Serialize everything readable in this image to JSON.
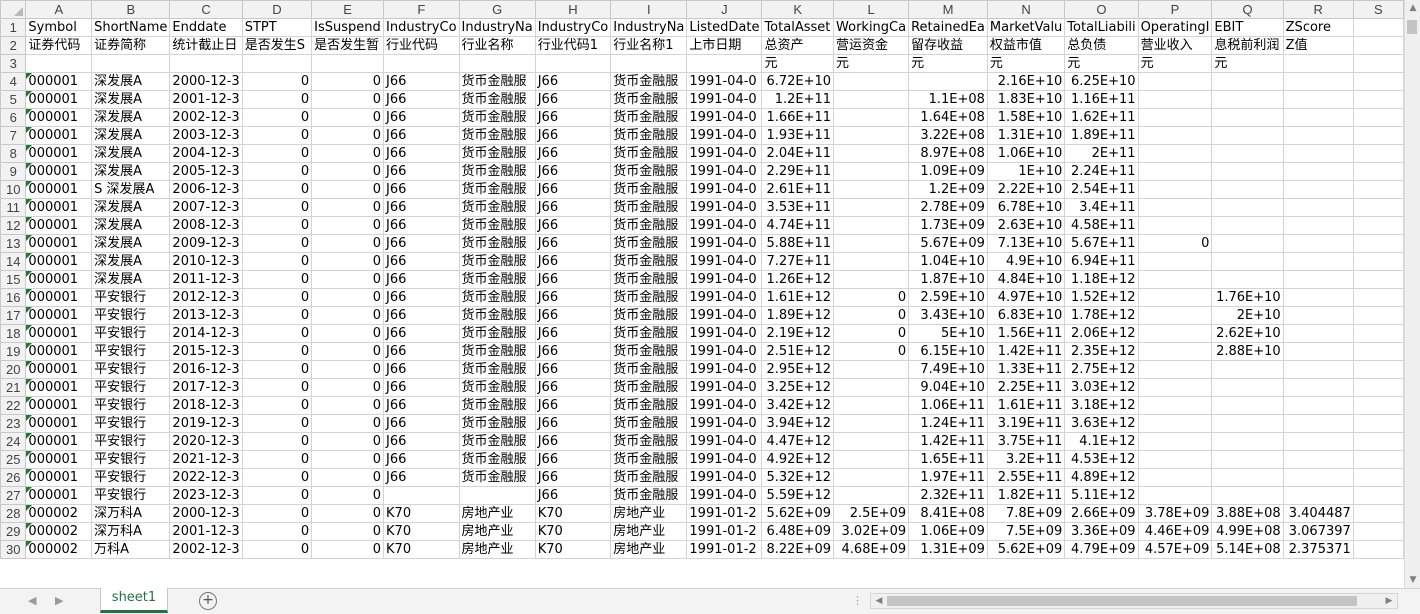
{
  "spreadsheet": {
    "columns": [
      "A",
      "B",
      "C",
      "D",
      "E",
      "F",
      "G",
      "H",
      "I",
      "J",
      "K",
      "L",
      "M",
      "N",
      "O",
      "P",
      "Q",
      "R",
      "S"
    ],
    "rows": [
      {
        "n": "1",
        "cells": [
          "Symbol",
          "ShortName",
          "Enddate",
          "STPT",
          "IsSuspend",
          "IndustryCo",
          "IndustryNa",
          "IndustryCo",
          "IndustryNa",
          "ListedDate",
          "TotalAsset",
          "WorkingCa",
          "RetainedEa",
          "MarketValu",
          "TotalLiabili",
          "OperatingI",
          "EBIT",
          "ZScore",
          ""
        ]
      },
      {
        "n": "2",
        "cells": [
          "证券代码",
          "证券简称",
          "统计截止日",
          "是否发生S",
          "是否发生暂",
          "行业代码",
          "行业名称",
          "行业代码1",
          "行业名称1",
          "上市日期",
          "总资产",
          "营运资金",
          "留存收益",
          "权益市值",
          "总负债",
          "营业收入",
          "息税前利润",
          "Z值",
          ""
        ]
      },
      {
        "n": "3",
        "cells": [
          "",
          "",
          "",
          "",
          "",
          "",
          "",
          "",
          "",
          "",
          "元",
          "元",
          "元",
          "元",
          "元",
          "元",
          "元",
          "",
          ""
        ]
      },
      {
        "n": "4",
        "cells": [
          "000001",
          "深发展A",
          "2000-12-3",
          "0",
          "0",
          "J66",
          "货币金融服",
          "J66",
          "货币金融服",
          "1991-04-0",
          "6.72E+10",
          "",
          "",
          "2.16E+10",
          "6.25E+10",
          "",
          "",
          "",
          ""
        ]
      },
      {
        "n": "5",
        "cells": [
          "000001",
          "深发展A",
          "2001-12-3",
          "0",
          "0",
          "J66",
          "货币金融服",
          "J66",
          "货币金融服",
          "1991-04-0",
          "1.2E+11",
          "",
          "1.1E+08",
          "1.83E+10",
          "1.16E+11",
          "",
          "",
          "",
          ""
        ]
      },
      {
        "n": "6",
        "cells": [
          "000001",
          "深发展A",
          "2002-12-3",
          "0",
          "0",
          "J66",
          "货币金融服",
          "J66",
          "货币金融服",
          "1991-04-0",
          "1.66E+11",
          "",
          "1.64E+08",
          "1.58E+10",
          "1.62E+11",
          "",
          "",
          "",
          ""
        ]
      },
      {
        "n": "7",
        "cells": [
          "000001",
          "深发展A",
          "2003-12-3",
          "0",
          "0",
          "J66",
          "货币金融服",
          "J66",
          "货币金融服",
          "1991-04-0",
          "1.93E+11",
          "",
          "3.22E+08",
          "1.31E+10",
          "1.89E+11",
          "",
          "",
          "",
          ""
        ]
      },
      {
        "n": "8",
        "cells": [
          "000001",
          "深发展A",
          "2004-12-3",
          "0",
          "0",
          "J66",
          "货币金融服",
          "J66",
          "货币金融服",
          "1991-04-0",
          "2.04E+11",
          "",
          "8.97E+08",
          "1.06E+10",
          "2E+11",
          "",
          "",
          "",
          ""
        ]
      },
      {
        "n": "9",
        "cells": [
          "000001",
          "深发展A",
          "2005-12-3",
          "0",
          "0",
          "J66",
          "货币金融服",
          "J66",
          "货币金融服",
          "1991-04-0",
          "2.29E+11",
          "",
          "1.09E+09",
          "1E+10",
          "2.24E+11",
          "",
          "",
          "",
          ""
        ]
      },
      {
        "n": "10",
        "cells": [
          "000001",
          "S 深发展A",
          "2006-12-3",
          "0",
          "0",
          "J66",
          "货币金融服",
          "J66",
          "货币金融服",
          "1991-04-0",
          "2.61E+11",
          "",
          "1.2E+09",
          "2.22E+10",
          "2.54E+11",
          "",
          "",
          "",
          ""
        ]
      },
      {
        "n": "11",
        "cells": [
          "000001",
          "深发展A",
          "2007-12-3",
          "0",
          "0",
          "J66",
          "货币金融服",
          "J66",
          "货币金融服",
          "1991-04-0",
          "3.53E+11",
          "",
          "2.78E+09",
          "6.78E+10",
          "3.4E+11",
          "",
          "",
          "",
          ""
        ]
      },
      {
        "n": "12",
        "cells": [
          "000001",
          "深发展A",
          "2008-12-3",
          "0",
          "0",
          "J66",
          "货币金融服",
          "J66",
          "货币金融服",
          "1991-04-0",
          "4.74E+11",
          "",
          "1.73E+09",
          "2.63E+10",
          "4.58E+11",
          "",
          "",
          "",
          ""
        ]
      },
      {
        "n": "13",
        "cells": [
          "000001",
          "深发展A",
          "2009-12-3",
          "0",
          "0",
          "J66",
          "货币金融服",
          "J66",
          "货币金融服",
          "1991-04-0",
          "5.88E+11",
          "",
          "5.67E+09",
          "7.13E+10",
          "5.67E+11",
          "0",
          "",
          "",
          ""
        ]
      },
      {
        "n": "14",
        "cells": [
          "000001",
          "深发展A",
          "2010-12-3",
          "0",
          "0",
          "J66",
          "货币金融服",
          "J66",
          "货币金融服",
          "1991-04-0",
          "7.27E+11",
          "",
          "1.04E+10",
          "4.9E+10",
          "6.94E+11",
          "",
          "",
          "",
          ""
        ]
      },
      {
        "n": "15",
        "cells": [
          "000001",
          "深发展A",
          "2011-12-3",
          "0",
          "0",
          "J66",
          "货币金融服",
          "J66",
          "货币金融服",
          "1991-04-0",
          "1.26E+12",
          "",
          "1.87E+10",
          "4.84E+10",
          "1.18E+12",
          "",
          "",
          "",
          ""
        ]
      },
      {
        "n": "16",
        "cells": [
          "000001",
          "平安银行",
          "2012-12-3",
          "0",
          "0",
          "J66",
          "货币金融服",
          "J66",
          "货币金融服",
          "1991-04-0",
          "1.61E+12",
          "0",
          "2.59E+10",
          "4.97E+10",
          "1.52E+12",
          "",
          "1.76E+10",
          "",
          ""
        ]
      },
      {
        "n": "17",
        "cells": [
          "000001",
          "平安银行",
          "2013-12-3",
          "0",
          "0",
          "J66",
          "货币金融服",
          "J66",
          "货币金融服",
          "1991-04-0",
          "1.89E+12",
          "0",
          "3.43E+10",
          "6.83E+10",
          "1.78E+12",
          "",
          "2E+10",
          "",
          ""
        ]
      },
      {
        "n": "18",
        "cells": [
          "000001",
          "平安银行",
          "2014-12-3",
          "0",
          "0",
          "J66",
          "货币金融服",
          "J66",
          "货币金融服",
          "1991-04-0",
          "2.19E+12",
          "0",
          "5E+10",
          "1.56E+11",
          "2.06E+12",
          "",
          "2.62E+10",
          "",
          ""
        ]
      },
      {
        "n": "19",
        "cells": [
          "000001",
          "平安银行",
          "2015-12-3",
          "0",
          "0",
          "J66",
          "货币金融服",
          "J66",
          "货币金融服",
          "1991-04-0",
          "2.51E+12",
          "0",
          "6.15E+10",
          "1.42E+11",
          "2.35E+12",
          "",
          "2.88E+10",
          "",
          ""
        ]
      },
      {
        "n": "20",
        "cells": [
          "000001",
          "平安银行",
          "2016-12-3",
          "0",
          "0",
          "J66",
          "货币金融服",
          "J66",
          "货币金融服",
          "1991-04-0",
          "2.95E+12",
          "",
          "7.49E+10",
          "1.33E+11",
          "2.75E+12",
          "",
          "",
          "",
          ""
        ]
      },
      {
        "n": "21",
        "cells": [
          "000001",
          "平安银行",
          "2017-12-3",
          "0",
          "0",
          "J66",
          "货币金融服",
          "J66",
          "货币金融服",
          "1991-04-0",
          "3.25E+12",
          "",
          "9.04E+10",
          "2.25E+11",
          "3.03E+12",
          "",
          "",
          "",
          ""
        ]
      },
      {
        "n": "22",
        "cells": [
          "000001",
          "平安银行",
          "2018-12-3",
          "0",
          "0",
          "J66",
          "货币金融服",
          "J66",
          "货币金融服",
          "1991-04-0",
          "3.42E+12",
          "",
          "1.06E+11",
          "1.61E+11",
          "3.18E+12",
          "",
          "",
          "",
          ""
        ]
      },
      {
        "n": "23",
        "cells": [
          "000001",
          "平安银行",
          "2019-12-3",
          "0",
          "0",
          "J66",
          "货币金融服",
          "J66",
          "货币金融服",
          "1991-04-0",
          "3.94E+12",
          "",
          "1.24E+11",
          "3.19E+11",
          "3.63E+12",
          "",
          "",
          "",
          ""
        ]
      },
      {
        "n": "24",
        "cells": [
          "000001",
          "平安银行",
          "2020-12-3",
          "0",
          "0",
          "J66",
          "货币金融服",
          "J66",
          "货币金融服",
          "1991-04-0",
          "4.47E+12",
          "",
          "1.42E+11",
          "3.75E+11",
          "4.1E+12",
          "",
          "",
          "",
          ""
        ]
      },
      {
        "n": "25",
        "cells": [
          "000001",
          "平安银行",
          "2021-12-3",
          "0",
          "0",
          "J66",
          "货币金融服",
          "J66",
          "货币金融服",
          "1991-04-0",
          "4.92E+12",
          "",
          "1.65E+11",
          "3.2E+11",
          "4.53E+12",
          "",
          "",
          "",
          ""
        ]
      },
      {
        "n": "26",
        "cells": [
          "000001",
          "平安银行",
          "2022-12-3",
          "0",
          "0",
          "J66",
          "货币金融服",
          "J66",
          "货币金融服",
          "1991-04-0",
          "5.32E+12",
          "",
          "1.97E+11",
          "2.55E+11",
          "4.89E+12",
          "",
          "",
          "",
          ""
        ]
      },
      {
        "n": "27",
        "cells": [
          "000001",
          "平安银行",
          "2023-12-3",
          "0",
          "0",
          "",
          "",
          "J66",
          "货币金融服",
          "1991-04-0",
          "5.59E+12",
          "",
          "2.32E+11",
          "1.82E+11",
          "5.11E+12",
          "",
          "",
          "",
          ""
        ]
      },
      {
        "n": "28",
        "cells": [
          "000002",
          "深万科A",
          "2000-12-3",
          "0",
          "0",
          "K70",
          "房地产业",
          "K70",
          "房地产业",
          "1991-01-2",
          "5.62E+09",
          "2.5E+09",
          "8.41E+08",
          "7.8E+09",
          "2.66E+09",
          "3.78E+09",
          "3.88E+08",
          "3.404487",
          ""
        ]
      },
      {
        "n": "29",
        "cells": [
          "000002",
          "深万科A",
          "2001-12-3",
          "0",
          "0",
          "K70",
          "房地产业",
          "K70",
          "房地产业",
          "1991-01-2",
          "6.48E+09",
          "3.02E+09",
          "1.06E+09",
          "7.5E+09",
          "3.36E+09",
          "4.46E+09",
          "4.99E+08",
          "3.067397",
          ""
        ]
      },
      {
        "n": "30",
        "cells": [
          "000002",
          "万科A",
          "2002-12-3",
          "0",
          "0",
          "K70",
          "房地产业",
          "K70",
          "房地产业",
          "1991-01-2",
          "8.22E+09",
          "4.68E+09",
          "1.31E+09",
          "5.62E+09",
          "4.79E+09",
          "4.57E+09",
          "5.14E+08",
          "2.375371",
          ""
        ]
      }
    ]
  },
  "sheet_tabs": [
    "sheet1"
  ],
  "add_sheet_label": "+",
  "nav": {
    "prev": "◀",
    "next": "▶"
  },
  "scroll": {
    "up": "▲",
    "down": "▼",
    "left": "◀",
    "right": "▶"
  },
  "colors": {
    "accent": "#217346",
    "header_bg": "#f2f2f2",
    "grid": "#d4d4d4"
  }
}
